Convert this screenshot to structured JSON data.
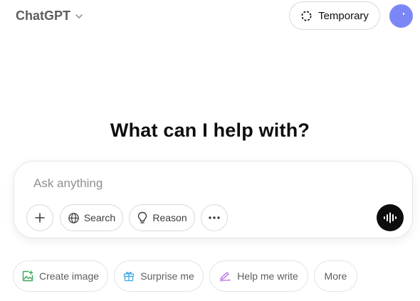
{
  "header": {
    "model_name": "ChatGPT",
    "temporary_label": "Temporary"
  },
  "icons": {
    "model_dropdown": "chevron-down-icon",
    "temporary": "dashed-circle-icon",
    "add": "plus-icon",
    "search": "globe-icon",
    "reason": "lightbulb-icon",
    "more_tools": "ellipsis-icon",
    "voice": "voice-waveform-icon",
    "create_image": "image-icon",
    "surprise": "gift-icon",
    "write": "pen-icon"
  },
  "main": {
    "headline": "What can I help with?"
  },
  "composer": {
    "placeholder": "Ask anything",
    "value": "",
    "tools": {
      "search_label": "Search",
      "reason_label": "Reason"
    }
  },
  "suggestions": {
    "create_image": "Create image",
    "surprise_me": "Surprise me",
    "help_me_write": "Help me write",
    "more": "More"
  },
  "colors": {
    "avatar": "#7b87f5",
    "create_image_icon": "#3ca65a",
    "surprise_icon": "#3fa7e8",
    "write_icon": "#b46be6",
    "voice_button": "#0d0d0d"
  }
}
